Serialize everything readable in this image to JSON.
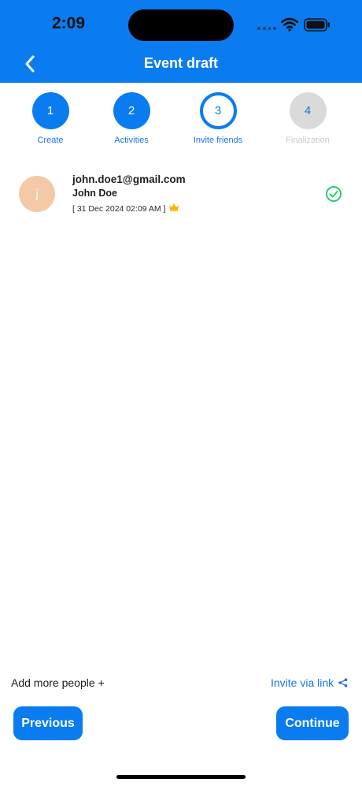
{
  "status_bar": {
    "time": "2:09"
  },
  "header": {
    "title": "Event draft"
  },
  "steps": [
    {
      "number": "1",
      "label": "Create",
      "state": "done"
    },
    {
      "number": "2",
      "label": "Activities",
      "state": "done"
    },
    {
      "number": "3",
      "label": "Invite friends",
      "state": "active"
    },
    {
      "number": "4",
      "label": "Finalization",
      "state": "pending"
    }
  ],
  "invitee": {
    "avatar_initial": "j",
    "email": "john.doe1@gmail.com",
    "name": "John Doe",
    "date": "[ 31 Dec 2024 02:09 AM ]",
    "status_icon": "check-circle-icon",
    "owner_icon": "crown-icon"
  },
  "footer": {
    "add_more_label": "Add more people +",
    "invite_link_label": "Invite via link",
    "previous_label": "Previous",
    "continue_label": "Continue"
  },
  "colors": {
    "primary": "#0a7cf0",
    "success": "#2ecc71",
    "crown": "#f2b705",
    "avatar_bg": "#f3c9a8",
    "pending": "#dadada"
  }
}
